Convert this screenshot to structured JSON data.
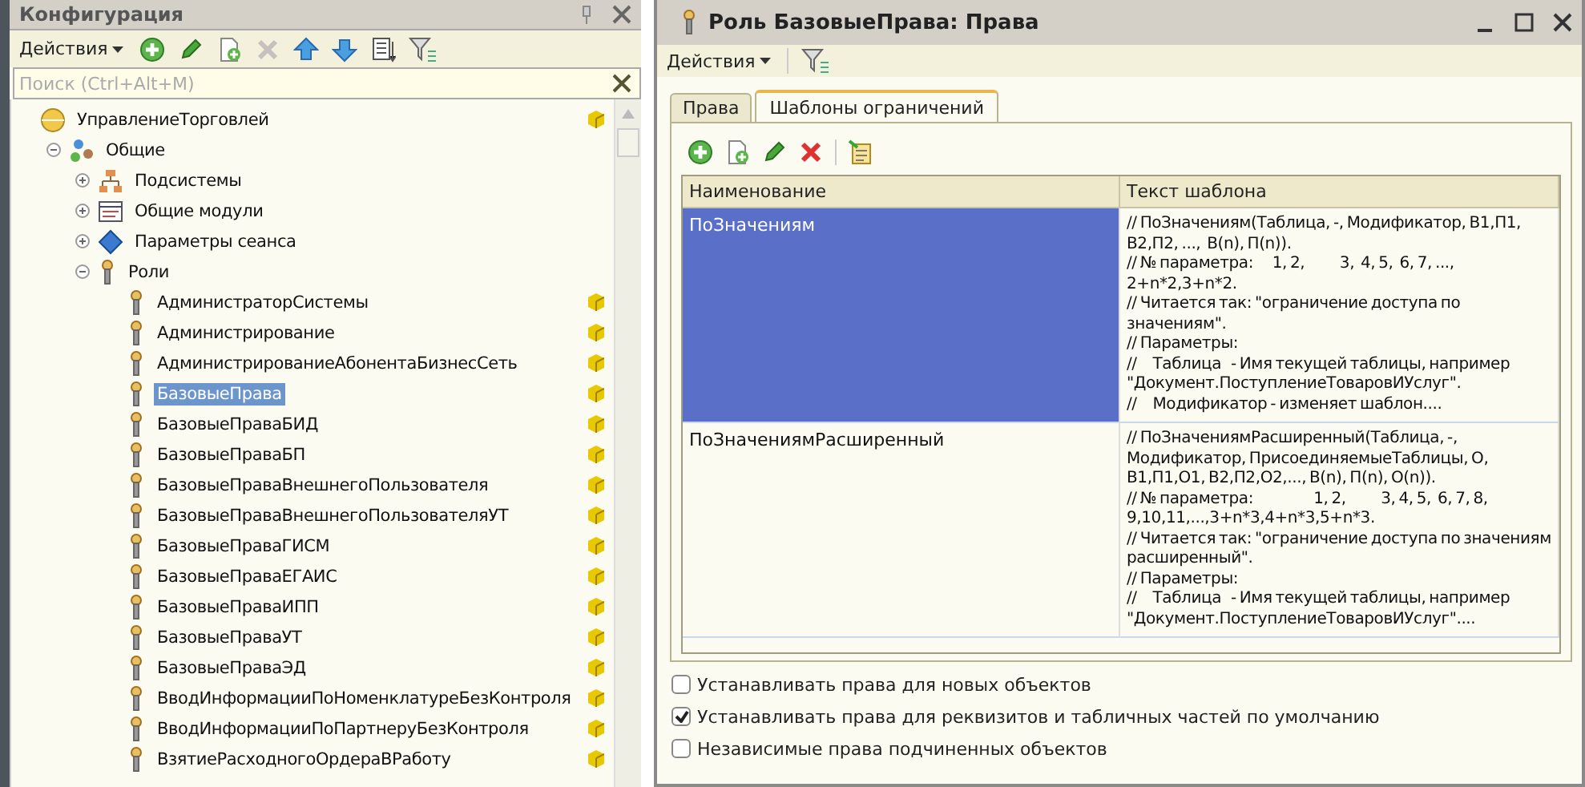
{
  "left_panel": {
    "title": "Конфигурация",
    "toolbar": {
      "actions": "Действия"
    },
    "search": {
      "placeholder": "Поиск (Ctrl+Alt+M)"
    },
    "tree": [
      {
        "label": "УправлениеТорговлей",
        "kind": "config",
        "supported": true,
        "selected": false,
        "children": [
          {
            "label": "Общие",
            "kind": "common",
            "expanded": true,
            "selected": false,
            "children": [
              {
                "label": "Подсистемы",
                "kind": "subsystems",
                "expanded": false,
                "selected": false
              },
              {
                "label": "Общие модули",
                "kind": "modules",
                "expanded": false,
                "selected": false
              },
              {
                "label": "Параметры сеанса",
                "kind": "params",
                "expanded": false,
                "selected": false
              },
              {
                "label": "Роли",
                "kind": "roles",
                "expanded": true,
                "selected": false,
                "children": [
                  {
                    "label": "АдминистраторСистемы",
                    "kind": "role",
                    "supported": true,
                    "selected": false
                  },
                  {
                    "label": "Администрирование",
                    "kind": "role",
                    "supported": true,
                    "selected": false
                  },
                  {
                    "label": "АдминистрированиеАбонентаБизнесСеть",
                    "kind": "role",
                    "supported": true,
                    "selected": false
                  },
                  {
                    "label": "БазовыеПрава",
                    "kind": "role",
                    "supported": true,
                    "selected": true
                  },
                  {
                    "label": "БазовыеПраваБИД",
                    "kind": "role",
                    "supported": true,
                    "selected": false
                  },
                  {
                    "label": "БазовыеПраваБП",
                    "kind": "role",
                    "supported": true,
                    "selected": false
                  },
                  {
                    "label": "БазовыеПраваВнешнегоПользователя",
                    "kind": "role",
                    "supported": true,
                    "selected": false
                  },
                  {
                    "label": "БазовыеПраваВнешнегоПользователяУТ",
                    "kind": "role",
                    "supported": true,
                    "selected": false
                  },
                  {
                    "label": "БазовыеПраваГИСМ",
                    "kind": "role",
                    "supported": true,
                    "selected": false
                  },
                  {
                    "label": "БазовыеПраваЕГАИС",
                    "kind": "role",
                    "supported": true,
                    "selected": false
                  },
                  {
                    "label": "БазовыеПраваИПП",
                    "kind": "role",
                    "supported": true,
                    "selected": false
                  },
                  {
                    "label": "БазовыеПраваУТ",
                    "kind": "role",
                    "supported": true,
                    "selected": false
                  },
                  {
                    "label": "БазовыеПраваЭД",
                    "kind": "role",
                    "supported": true,
                    "selected": false
                  },
                  {
                    "label": "ВводИнформацииПоНоменклатуреБезКонтроля",
                    "kind": "role",
                    "supported": true,
                    "selected": false
                  },
                  {
                    "label": "ВводИнформацииПоПартнеруБезКонтроля",
                    "kind": "role",
                    "supported": true,
                    "selected": false
                  },
                  {
                    "label": "ВзятиеРасходногоОрдераВРаботу",
                    "kind": "role",
                    "supported": true,
                    "selected": false
                  }
                ]
              }
            ]
          }
        ]
      }
    ]
  },
  "window": {
    "title": "Роль БазовыеПрава: Права",
    "toolbar": {
      "actions": "Действия"
    },
    "tabs": [
      {
        "label": "Права",
        "selected": false
      },
      {
        "label": "Шаблоны ограничений",
        "selected": true
      }
    ],
    "table": {
      "columns": [
        "Наименование",
        "Текст шаблона"
      ],
      "rows": [
        {
          "name": "ПоЗначениям",
          "selected": true,
          "text": [
            "// ПоЗначениям(Таблица, -, Модификатор, В1,П1, В2,П2, ...,  В(n), П(n)).",
            "// № параметра:      1, 2,           3,  4, 5,  6, 7, ...,  2+n*2,3+n*2.",
            "// Читается так: \"ограничение доступа по значениям\".",
            "// Параметры:",
            "//     Таблица   - Имя текущей таблицы, например \"Документ.ПоступлениеТоваровИУслуг\".",
            "//     Модификатор - изменяет шаблон...."
          ]
        },
        {
          "name": "ПоЗначениямРасширенный",
          "selected": false,
          "text": [
            "// ПоЗначениямРасширенный(Таблица, -, Модификатор, ПрисоединяемыеТаблицы, О, В1,П1,О1, В2,П2,О2,..., В(n), П(n), О(n)).",
            "// № параметра:                   1, 2,           3, 4, 5,  6, 7, 8,  9,10,11,...,3+n*3,4+n*3,5+n*3.",
            "// Читается так: \"ограничение доступа по значениям расширенный\".",
            "// Параметры:",
            "//     Таблица   - Имя текущей таблицы, например \"Документ.ПоступлениеТоваровИУслуг\"...."
          ]
        }
      ]
    },
    "options": [
      {
        "label": "Устанавливать права для новых объектов",
        "checked": false
      },
      {
        "label": "Устанавливать права для реквизитов и табличных частей по умолчанию",
        "checked": true
      },
      {
        "label": "Независимые права подчиненных объектов",
        "checked": false
      }
    ]
  }
}
